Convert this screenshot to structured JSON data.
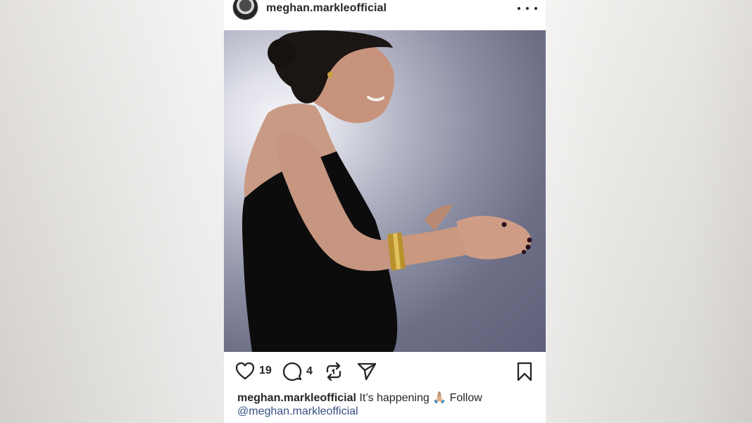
{
  "post": {
    "username": "meghan.markleofficial",
    "likes": "19",
    "comments": "4",
    "caption_user": "meghan.markleofficial",
    "caption_text": "It’s happening 🙏🏼 Follow",
    "caption_mention": "@meghan.markleofficial"
  },
  "icons": {
    "more": "more-options-icon",
    "like": "heart-icon",
    "comment": "comment-bubble-icon",
    "repost": "repost-icon",
    "share": "send-icon",
    "save": "bookmark-icon"
  },
  "colors": {
    "text": "#262626",
    "mention": "#385185",
    "background_panel": "#ffffff"
  }
}
